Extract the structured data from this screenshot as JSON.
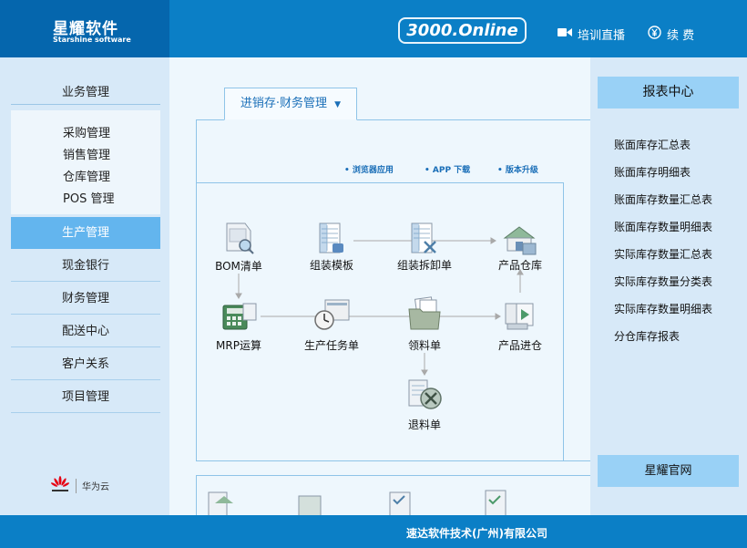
{
  "brand": {
    "title": "星耀软件",
    "subtitle": "Starshine software"
  },
  "header": {
    "online_label": "3000.Online",
    "training_icon": "video-camera-icon",
    "training_label": "培训直播",
    "renew_icon": "yen-circle-icon",
    "renew_label": "续 费"
  },
  "sidebar": {
    "title": "业务管理",
    "sub_items": [
      "采购管理",
      "销售管理",
      "仓库管理",
      "POS 管理"
    ],
    "items": [
      "生产管理",
      "现金银行",
      "财务管理",
      "配送中心",
      "客户关系",
      "项目管理"
    ],
    "active_item": "生产管理",
    "partner_label": "华为云",
    "partner_icon": "huawei-logo-icon"
  },
  "main": {
    "tab_label": "进销存·财务管理",
    "tab_icon": "caret-down-icon",
    "links": [
      "• 浏览器应用",
      "• APP 下载",
      "• 版本升级"
    ],
    "flow_nodes": [
      {
        "label": "BOM清单",
        "icon": "bom-scanner-icon"
      },
      {
        "label": "组装模板",
        "icon": "template-sheet-icon"
      },
      {
        "label": "组装拆卸单",
        "icon": "disassembly-sheet-icon"
      },
      {
        "label": "产品仓库",
        "icon": "warehouse-icon"
      },
      {
        "label": "MRP运算",
        "icon": "mrp-calculator-icon"
      },
      {
        "label": "生产任务单",
        "icon": "task-clock-icon"
      },
      {
        "label": "领料单",
        "icon": "folder-docs-icon"
      },
      {
        "label": "产品进仓",
        "icon": "product-in-icon"
      },
      {
        "label": "退料单",
        "icon": "return-cancel-icon"
      }
    ]
  },
  "rightbar": {
    "title": "报表中心",
    "items": [
      "账面库存汇总表",
      "账面库存明细表",
      "账面库存数量汇总表",
      "账面库存数量明细表",
      "实际库存数量汇总表",
      "实际库存数量分类表",
      "实际库存数量明细表",
      "分仓库存报表"
    ],
    "official_label": "星耀官网"
  },
  "footer": {
    "company": "速达软件技术(广州)有限公司"
  },
  "colors": {
    "header_blue": "#0b7fc6",
    "logo_blue": "#0566ad",
    "sidebar_bg": "#d7e9f8",
    "active_item": "#63b5ee",
    "report_title_bg": "#99d1f6"
  }
}
